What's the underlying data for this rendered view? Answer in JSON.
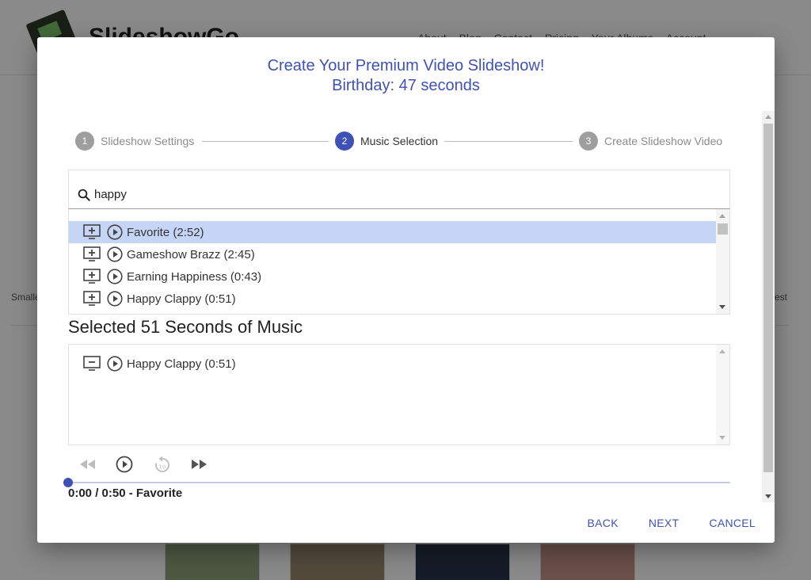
{
  "background": {
    "brand": "SlideshowGo",
    "nav": [
      "About",
      "Blog",
      "Contact",
      "Pricing",
      "Your Albums",
      "Account"
    ],
    "left_text": "Smalle",
    "right_text": "est"
  },
  "dialog": {
    "title": "Create Your Premium Video Slideshow!",
    "subtitle": "Birthday: 47 seconds"
  },
  "stepper": {
    "steps": [
      {
        "number": "1",
        "label": "Slideshow Settings",
        "state": "inactive"
      },
      {
        "number": "2",
        "label": "Music Selection",
        "state": "active"
      },
      {
        "number": "3",
        "label": "Create Slideshow Video",
        "state": "inactive"
      }
    ]
  },
  "search": {
    "value": "happy",
    "icon": "search-icon"
  },
  "music_list": {
    "tracks": [
      {
        "name": "Favorite (2:52)",
        "selected": true
      },
      {
        "name": "Gameshow Brazz (2:45)",
        "selected": false
      },
      {
        "name": "Earning Happiness (0:43)",
        "selected": false
      },
      {
        "name": "Happy Clappy (0:51)",
        "selected": false
      }
    ]
  },
  "selected_music": {
    "heading": "Selected 51 Seconds of Music",
    "tracks": [
      {
        "name": "Happy Clappy (0:51)"
      }
    ]
  },
  "player": {
    "time": "0:00 / 0:50 - Favorite",
    "progress": 0,
    "icons": [
      "rewind-icon",
      "play-circle-icon",
      "replay-10-icon",
      "fast-forward-icon"
    ]
  },
  "actions": {
    "back": "BACK",
    "next": "NEXT",
    "cancel": "CANCEL"
  },
  "colors": {
    "accent": "#3f51b5",
    "selected_row": "#c5d5f5",
    "inactive_step": "#9e9e9e"
  }
}
